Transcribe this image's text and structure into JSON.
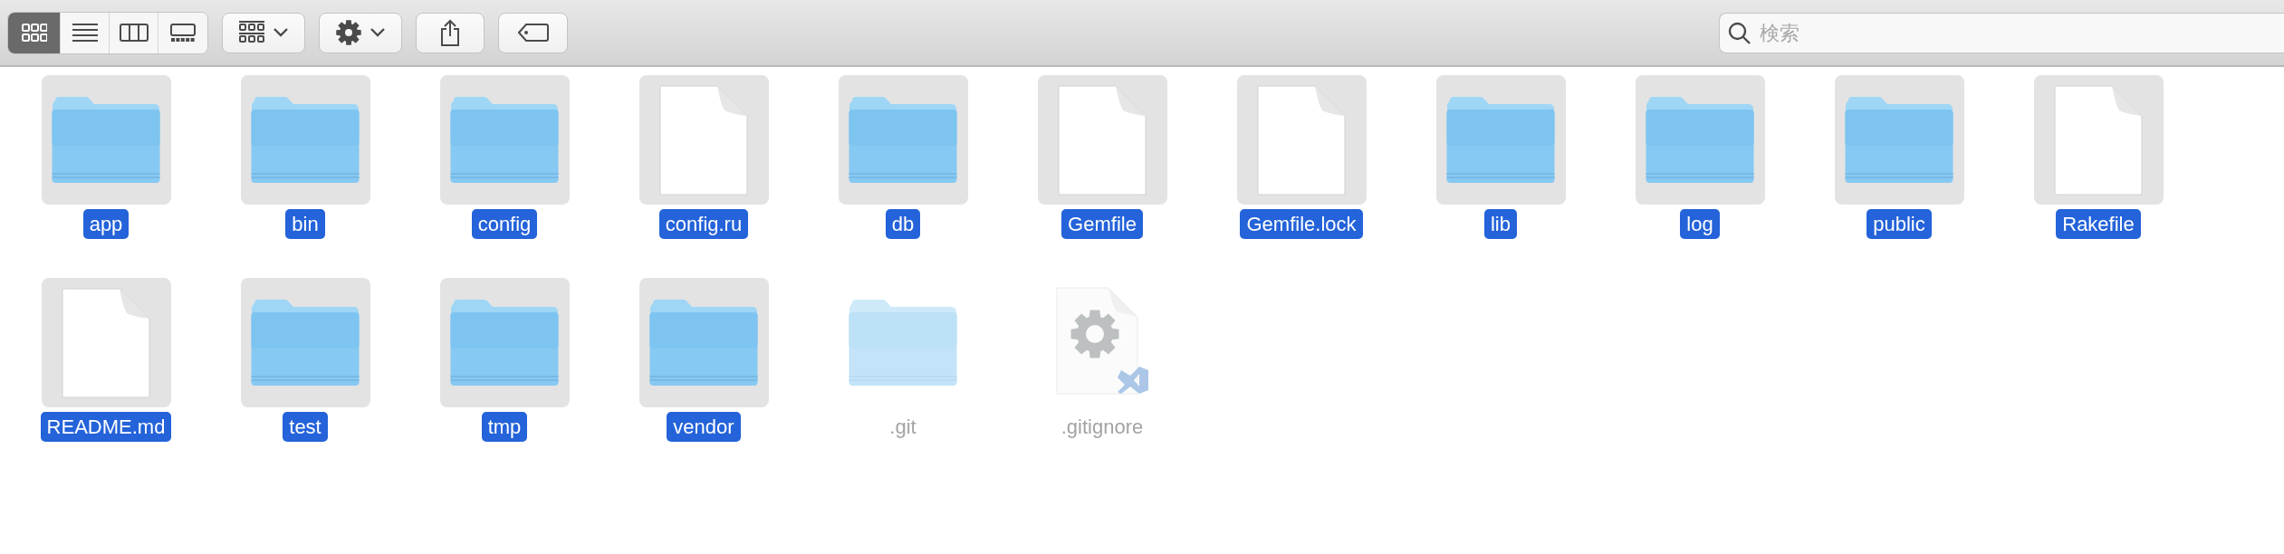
{
  "toolbar": {
    "view_modes": [
      {
        "kind": "icons",
        "selected": true
      },
      {
        "kind": "list",
        "selected": false
      },
      {
        "kind": "columns",
        "selected": false
      },
      {
        "kind": "gallery",
        "selected": false
      }
    ],
    "buttons": [
      {
        "kind": "group"
      },
      {
        "kind": "action"
      },
      {
        "kind": "share"
      },
      {
        "kind": "tag"
      }
    ],
    "search": {
      "placeholder": "検索"
    }
  },
  "items": [
    {
      "name": "app",
      "kind": "folder",
      "selected": true,
      "hidden": false
    },
    {
      "name": "bin",
      "kind": "folder",
      "selected": true,
      "hidden": false
    },
    {
      "name": "config",
      "kind": "folder",
      "selected": true,
      "hidden": false
    },
    {
      "name": "config.ru",
      "kind": "document",
      "selected": true,
      "hidden": false
    },
    {
      "name": "db",
      "kind": "folder",
      "selected": true,
      "hidden": false
    },
    {
      "name": "Gemfile",
      "kind": "document",
      "selected": true,
      "hidden": false
    },
    {
      "name": "Gemfile.lock",
      "kind": "document",
      "selected": true,
      "hidden": false
    },
    {
      "name": "lib",
      "kind": "folder",
      "selected": true,
      "hidden": false
    },
    {
      "name": "log",
      "kind": "folder",
      "selected": true,
      "hidden": false
    },
    {
      "name": "public",
      "kind": "folder",
      "selected": true,
      "hidden": false
    },
    {
      "name": "Rakefile",
      "kind": "document",
      "selected": true,
      "hidden": false
    },
    {
      "name": "README.md",
      "kind": "document",
      "selected": true,
      "hidden": false
    },
    {
      "name": "test",
      "kind": "folder",
      "selected": true,
      "hidden": false
    },
    {
      "name": "tmp",
      "kind": "folder",
      "selected": true,
      "hidden": false
    },
    {
      "name": "vendor",
      "kind": "folder",
      "selected": true,
      "hidden": false
    },
    {
      "name": ".git",
      "kind": "folder",
      "selected": false,
      "hidden": true
    },
    {
      "name": ".gitignore",
      "kind": "config",
      "selected": false,
      "hidden": true
    }
  ]
}
